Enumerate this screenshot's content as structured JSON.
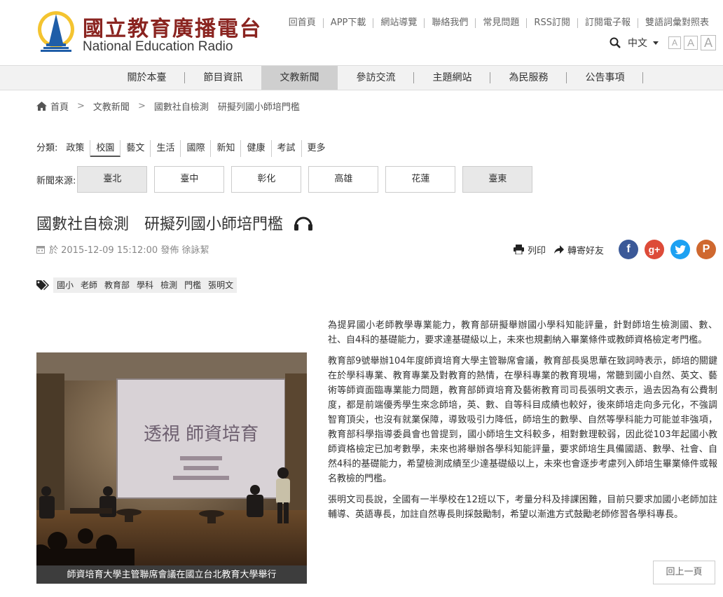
{
  "header": {
    "logo_zh": "國立教育廣播電台",
    "logo_en": "National Education Radio",
    "top_links": [
      "回首頁",
      "APP下載",
      "網站導覽",
      "聯絡我們",
      "常見問題",
      "RSS訂閱",
      "訂閱電子報",
      "雙語詞彙對照表"
    ],
    "language": "中文",
    "font_sizes": [
      "A",
      "A",
      "A"
    ]
  },
  "nav": {
    "items": [
      "關於本臺",
      "節目資訊",
      "文教新聞",
      "參訪交流",
      "主題網站",
      "為民服務",
      "公告事項"
    ],
    "active": "文教新聞"
  },
  "breadcrumb": [
    "首頁",
    "文教新聞",
    "國數社自檢測　研擬列國小師培門檻"
  ],
  "category": {
    "label": "分類:",
    "items": [
      "政策",
      "校園",
      "藝文",
      "生活",
      "國際",
      "新知",
      "健康",
      "考試",
      "更多"
    ],
    "active": "校園"
  },
  "source": {
    "label": "新聞來源:",
    "items": [
      "臺北",
      "臺中",
      "彰化",
      "高雄",
      "花蓮",
      "臺東"
    ]
  },
  "article": {
    "title": "國數社自檢測　研擬列國小師培門檻",
    "meta": "於 2015-12-09 15:12:00 發佈 徐詠絜",
    "print_label": "列印",
    "forward_label": "轉寄好友",
    "tags": [
      "國小",
      "老師",
      "教育部",
      "學科",
      "檢測",
      "門檻",
      "張明文"
    ],
    "photo_caption": "師資培育大學主管聯席會議在國立台北教育大學舉行",
    "photo_screen_text": "透視 師資培育",
    "paragraphs": [
      "為提昇國小老師教學專業能力，教育部研擬舉辦國小學科知能評量，針對師培生檢測國、數、社、自4科的基礎能力，要求達基礎級以上，未來也規劃納入畢業條件或教師資格檢定考門檻。",
      "教育部9號舉辦104年度師資培育大學主管聯席會議，教育部長吳思華在致詞時表示，師培的關鍵在於學科專業、教育專業及對教育的熱情，在學科專業的教育現場，常聽到國小自然、英文、藝術等師資面臨專業能力問題，教育部師資培育及藝術教育司司長張明文表示，過去因為有公費制度，都是前端優秀學生來念師培，英、數、自等科目成績也較好，後來師培走向多元化，不強調智育頂尖，也沒有就業保障，導致吸引力降低，師培生的數學、自然等學科能力可能並非強項，教育部科學指導委員會也曾提到，國小師培生文科較多，相對數理較弱，因此從103年起國小教師資格檢定已加考數學，未來也將舉辦各學科知能評量，要求師培生具備國語、數學、社會、自然4科的基礎能力，希望檢測成績至少達基礎級以上，未來也會逐步考慮列入師培生畢業條件或報名教檢的門檻。",
      "張明文司長說，全國有一半學校在12班以下，考量分科及排課困難，目前只要求加國小老師加註輔導、英語專長，加註自然專長則採鼓勵制，希望以漸進方式鼓勵老師修習各學科專長。"
    ],
    "back_label": "回上一頁"
  },
  "colors": {
    "brand": "#8a2420",
    "facebook": "#3b5998",
    "googleplus": "#dd4b39",
    "twitter": "#1da1f2",
    "plurk": "#cf682f"
  }
}
